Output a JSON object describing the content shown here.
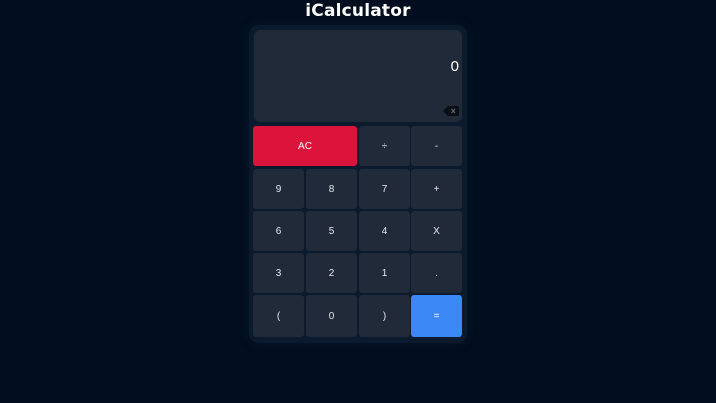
{
  "app": {
    "title": "iCalculator"
  },
  "display": {
    "value": "0",
    "backspace_icon": "backspace-icon"
  },
  "keys": {
    "clear": "AC",
    "divide": "÷",
    "minus": "-",
    "nine": "9",
    "eight": "8",
    "seven": "7",
    "plus": "+",
    "six": "6",
    "five": "5",
    "four": "4",
    "multiply": "X",
    "three": "3",
    "two": "2",
    "one": "1",
    "decimal": ".",
    "open_paren": "(",
    "zero": "0",
    "close_paren": ")",
    "equals": "="
  },
  "colors": {
    "background": "#010e1f",
    "key": "#202a38",
    "clear_key": "#dc143c",
    "equals_key": "#3b87f6"
  }
}
